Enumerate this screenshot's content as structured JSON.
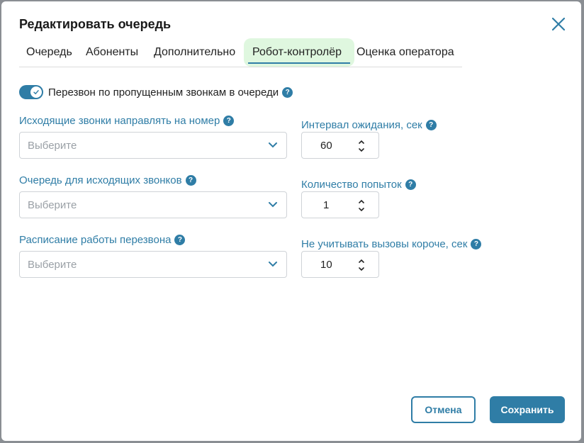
{
  "dialog": {
    "title": "Редактировать очередь",
    "tabs": [
      {
        "label": "Очередь"
      },
      {
        "label": "Абоненты"
      },
      {
        "label": "Дополнительно"
      },
      {
        "label": "Робот-контролёр"
      },
      {
        "label": "Оценка оператора"
      }
    ],
    "active_tab": "Робот-контролёр",
    "callback_toggle": {
      "label": "Перезвон по пропущенным звонкам в очереди",
      "enabled": true
    },
    "fields": {
      "outgoing_number": {
        "label": "Исходящие звонки направлять на номер",
        "placeholder": "Выберите"
      },
      "outgoing_queue": {
        "label": "Очередь для исходящих звонков",
        "placeholder": "Выберите"
      },
      "schedule": {
        "label": "Расписание работы перезвона",
        "placeholder": "Выберите"
      },
      "wait_interval": {
        "label": "Интервал ожидания, сек",
        "value": "60"
      },
      "attempts": {
        "label": "Количество попыток",
        "value": "1"
      },
      "min_call_length": {
        "label": "Не учитывать вызовы короче, сек",
        "value": "10"
      }
    },
    "help_glyph": "?",
    "buttons": {
      "cancel": "Отмена",
      "save": "Сохранить"
    },
    "colors": {
      "accent": "#2f7da6",
      "active_tab_bg": "#dff7df"
    }
  }
}
